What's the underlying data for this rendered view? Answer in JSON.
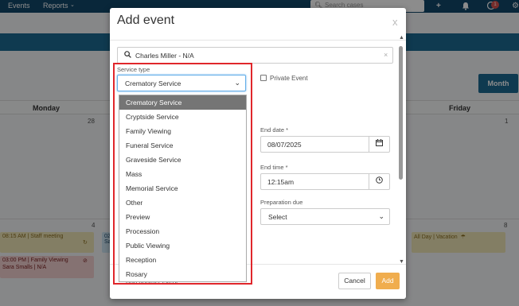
{
  "topbar": {
    "nav_events": "Events",
    "nav_reports": "Reports",
    "reports_caret": "⌄",
    "search_placeholder": "Search cases",
    "plus_icon": "plus-icon",
    "bell_icon": "bell-icon",
    "notification_count": "1"
  },
  "calendar": {
    "month_button": "Month",
    "day_monday": "Monday",
    "day_friday": "Friday",
    "num_28": "28",
    "num_1": "1",
    "num_4": "4",
    "num_8": "8",
    "event_staff_meeting": "08:15 AM | Staff meeting",
    "event_family_viewing_line1": "03:00 PM | Family Viewing",
    "event_family_viewing_line2": "Sara Smalls | N/A",
    "event_vacation": "All Day | Vacation",
    "event_partial_1": "02",
    "event_partial_2": "Sa"
  },
  "modal": {
    "title": "Add event",
    "close": "x",
    "contact_value": "Charles Miller - N/A",
    "contact_clear": "×",
    "service_type_label": "Service type",
    "service_type_value": "Crematory Service",
    "private_event_label": "Private Event",
    "end_date_label": "End date *",
    "end_date_value": "08/07/2025",
    "end_time_label": "End time *",
    "end_time_value": "12:15am",
    "prep_due_label": "Preparation due",
    "prep_due_value": "Select",
    "partial_footer_text": "Add another event",
    "cancel_label": "Cancel",
    "add_label": "Add"
  },
  "dropdown": {
    "options": [
      "Crematory Service",
      "Cryptside Service",
      "Family Viewing",
      "Funeral Service",
      "Graveside Service",
      "Mass",
      "Memorial Service",
      "Other",
      "Preview",
      "Procession",
      "Public Viewing",
      "Reception",
      "Rosary"
    ],
    "selected": "Crematory Service"
  },
  "colors": {
    "topbar": "#12476b",
    "accent": "#1d6a93",
    "highlight": "#e0262b",
    "add_button": "#f0ad4e",
    "selected_option": "#757575"
  }
}
